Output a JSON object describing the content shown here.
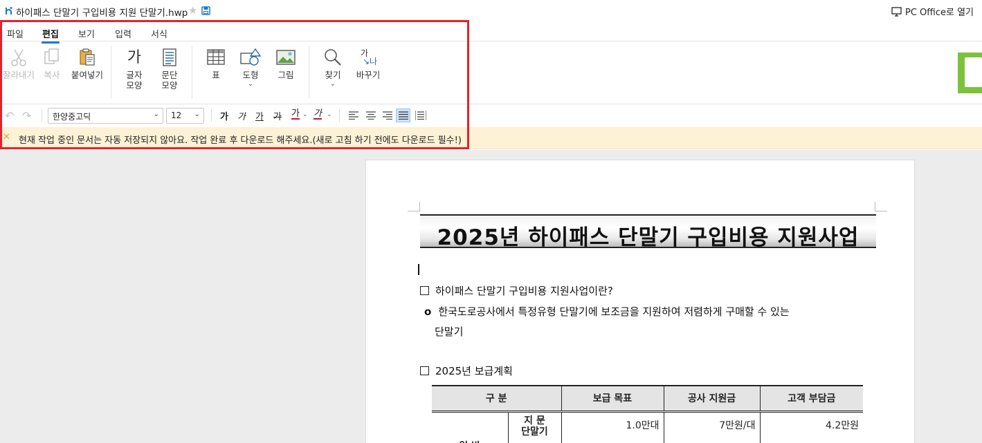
{
  "titlebar": {
    "doc_title": "하이패스 단말기 구입비용 지원 단말기.hwp",
    "pc_office_label": "PC Office로 열기"
  },
  "tabs": [
    {
      "label": "파일",
      "active": false
    },
    {
      "label": "편집",
      "active": true
    },
    {
      "label": "보기",
      "active": false
    },
    {
      "label": "입력",
      "active": false
    },
    {
      "label": "서식",
      "active": false
    }
  ],
  "ribbon": {
    "cut": "잘라내기",
    "copy": "복사",
    "paste": "붙여넣기",
    "char_shape_1": "글자",
    "char_shape_2": "모양",
    "para_shape_1": "문단",
    "para_shape_2": "모양",
    "table": "표",
    "shape": "도형",
    "picture": "그림",
    "find": "찾기",
    "replace": "바꾸기",
    "char_icon_text": "가",
    "replace_icon_top": "가",
    "replace_icon_bottom": "↘나"
  },
  "format_bar": {
    "font_name": "한양중고딕",
    "font_size": "12",
    "bold": "가",
    "italic": "가",
    "underline": "가",
    "strike": "가",
    "font_color": "가",
    "highlight": "가",
    "font_color_hex": "#c8102e",
    "highlight_hex": "#c8102e"
  },
  "warning": {
    "text": "현재 작업 중인 문서는 자동 저장되지 않아요. 작업 완료 후 다운로드 해주세요.(새로 고침 하기 전에도 다운로드 필수!)"
  },
  "document": {
    "heading": "2025년 하이패스 단말기 구입비용 지원사업",
    "section1_title": "하이패스 단말기 구입비용 지원사업이란?",
    "section1_bullet_mark": "o",
    "section1_body_line1": "한국도로공사에서 특정유형 단말기에 보조금을 지원하여 저렴하게 구매할 수 있는",
    "section1_body_line2": "단말기",
    "section2_title": "2025년 보급계획",
    "table": {
      "headers": [
        "구   분",
        "보급 목표",
        "공사 지원금",
        "고객 부담금"
      ],
      "row1": {
        "category": "일 반",
        "sub": "지 문\n단말기",
        "target": "1.0만대",
        "support": "7만원/대",
        "customer": "4.2만원"
      }
    }
  },
  "colors": {
    "accent": "#1b7ad6",
    "highlight_box": "#e5212b",
    "warning_bg": "#fdf1d6",
    "thumbnail_green": "#7cc23d"
  }
}
